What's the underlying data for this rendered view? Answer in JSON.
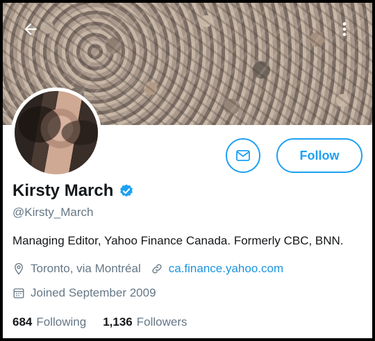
{
  "header": {
    "back_icon": "back-arrow-icon",
    "more_icon": "more-vertical-icon"
  },
  "profile": {
    "name": "Kirsty March",
    "handle": "@Kirsty_March",
    "bio": "Managing Editor, Yahoo Finance Canada. Formerly CBC, BNN.",
    "location": "Toronto, via Montréal",
    "website": "ca.finance.yahoo.com",
    "joined": "Joined September 2009",
    "verified": true
  },
  "actions": {
    "message_icon": "envelope-icon",
    "follow_label": "Follow"
  },
  "stats": {
    "following_count": "684",
    "following_label": "Following",
    "followers_count": "1,136",
    "followers_label": "Followers"
  },
  "colors": {
    "accent": "#1da1f2",
    "link": "#1b95e0",
    "text_primary": "#14171a",
    "text_secondary": "#657786"
  }
}
